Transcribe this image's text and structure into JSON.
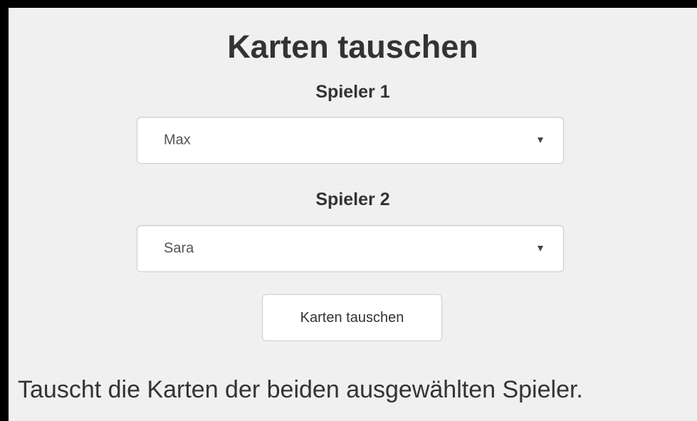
{
  "title": "Karten tauschen",
  "player1": {
    "label": "Spieler 1",
    "selected": "Max"
  },
  "player2": {
    "label": "Spieler 2",
    "selected": "Sara"
  },
  "swap_button_label": "Karten tauschen",
  "description": "Tauscht die Karten der beiden ausgewählten Spieler.",
  "icons": {
    "dropdown": "chevron-down-icon"
  },
  "colors": {
    "background": "#f0f0f0",
    "border": "#000000",
    "text": "#333333"
  }
}
